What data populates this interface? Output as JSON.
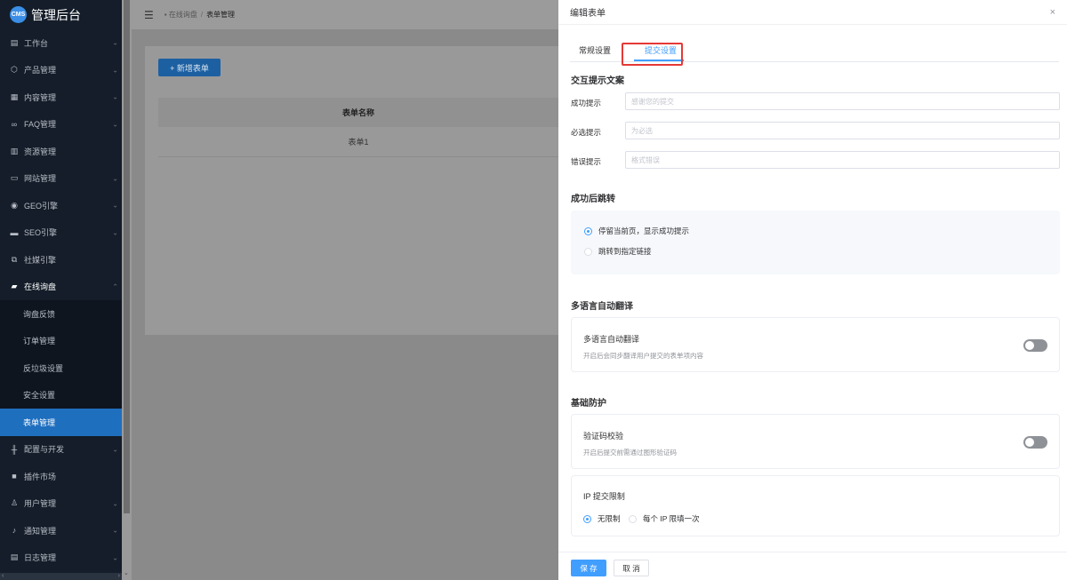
{
  "app": {
    "logo_badge": "CMS",
    "title": "管理后台"
  },
  "sidebar": {
    "items": [
      {
        "label": "工作台",
        "icon": "dashboard-icon",
        "chevron": "v"
      },
      {
        "label": "产品管理",
        "icon": "cube-icon",
        "chevron": "v"
      },
      {
        "label": "内容管理",
        "icon": "document-icon",
        "chevron": "v"
      },
      {
        "label": "FAQ管理",
        "icon": "link-icon",
        "chevron": "v"
      },
      {
        "label": "资源管理",
        "icon": "folder-icon",
        "chevron": "v"
      },
      {
        "label": "网站管理",
        "icon": "monitor-icon",
        "chevron": "v"
      },
      {
        "label": "GEO引擎",
        "icon": "globe-icon",
        "chevron": "v"
      },
      {
        "label": "SEO引擎",
        "icon": "chat-icon",
        "chevron": "v"
      },
      {
        "label": "社媒引擎",
        "icon": "share-icon",
        "chevron": "v"
      },
      {
        "label": "在线询盘",
        "icon": "message-icon",
        "chevron": "^"
      }
    ],
    "sub_items": [
      {
        "label": "询盘反馈"
      },
      {
        "label": "订单管理"
      },
      {
        "label": "反垃圾设置"
      },
      {
        "label": "安全设置"
      },
      {
        "label": "表单管理"
      }
    ],
    "bottom_items": [
      {
        "label": "配置与开发",
        "icon": "sliders-icon",
        "chevron": "v"
      },
      {
        "label": "插件市场",
        "icon": "lock-icon",
        "chevron": ""
      },
      {
        "label": "用户管理",
        "icon": "user-icon",
        "chevron": "v"
      },
      {
        "label": "通知管理",
        "icon": "bell-icon",
        "chevron": "v"
      },
      {
        "label": "日志管理",
        "icon": "log-icon",
        "chevron": "v"
      }
    ]
  },
  "header": {
    "breadcrumb": [
      "在线询盘",
      "表单管理"
    ],
    "separator": "/"
  },
  "page": {
    "new_button": "+ 新增表单",
    "table": {
      "header": "表单名称",
      "rows": [
        "表单1"
      ]
    }
  },
  "drawer": {
    "title": "编辑表单",
    "close": "×",
    "tabs": [
      "常规设置",
      "提交设置"
    ],
    "active_tab": "提交设置",
    "prompt_section": {
      "title": "交互提示文案",
      "fields": [
        {
          "label": "成功提示",
          "placeholder": "感谢您的提交"
        },
        {
          "label": "必选提示",
          "placeholder": "为必选"
        },
        {
          "label": "错误提示",
          "placeholder": "格式错误"
        }
      ]
    },
    "redirect_section": {
      "title": "成功后跳转",
      "options": [
        "停留当前页，显示成功提示",
        "跳转到指定链接"
      ],
      "selected": "停留当前页，显示成功提示"
    },
    "translate_section": {
      "title": "多语言自动翻译",
      "card_title": "多语言自动翻译",
      "card_desc": "开启后会同步翻译用户提交的表单项内容",
      "enabled": false
    },
    "protect_section": {
      "title": "基础防护",
      "captcha_title": "验证码校验",
      "captcha_desc": "开启后提交前需通过图形验证码",
      "captcha_enabled": false,
      "ip_title": "IP 提交限制",
      "ip_options": [
        "无限制",
        "每个 IP 限填一次"
      ],
      "ip_selected": "无限制"
    },
    "footer": {
      "save": "保 存",
      "cancel": "取 消"
    }
  }
}
